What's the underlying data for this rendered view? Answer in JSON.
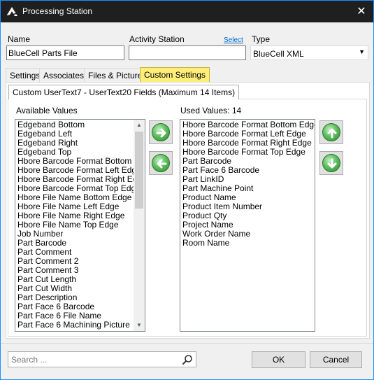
{
  "window": {
    "title": "Processing Station",
    "close_glyph": "✕",
    "icon": "app-logo-icon"
  },
  "fields": {
    "name_label": "Name",
    "name_value": "BlueCell Parts File",
    "activity_label": "Activity Station",
    "activity_select_link": "Select",
    "activity_value": "",
    "type_label": "Type",
    "type_value": "BlueCell XML"
  },
  "tabs": [
    {
      "label": "Settings"
    },
    {
      "label": "Associates"
    },
    {
      "label": "Files & Pictures"
    },
    {
      "label": "Custom Settings",
      "active": true
    }
  ],
  "subtab": {
    "label": "Custom UserText7 - UserText20 Fields (Maximum 14 Items)"
  },
  "available": {
    "label": "Available Values",
    "items": [
      "Edgeband Bottom",
      "Edgeband Left",
      "Edgeband Right",
      "Edgeband Top",
      "Hbore Barcode Format Bottom Edge",
      "Hbore Barcode Format Left Edge",
      "Hbore Barcode Format Right Edge",
      "Hbore Barcode Format Top Edge",
      "Hbore File Name Bottom Edge",
      "Hbore File Name Left Edge",
      "Hbore File Name Right Edge",
      "Hbore File Name Top Edge",
      "Job Number",
      "Part Barcode",
      "Part Comment",
      "Part Comment 2",
      "Part Comment 3",
      "Part Cut Length",
      "Part Cut Width",
      "Part Description",
      "Part Face 6 Barcode",
      "Part Face 6 File Name",
      "Part Face 6 Machining Picture"
    ]
  },
  "used": {
    "label": "Used Values: 14",
    "items": [
      "Hbore Barcode Format Bottom Edge",
      "Hbore Barcode Format Left Edge",
      "Hbore Barcode Format Right Edge",
      "Hbore Barcode Format Top Edge",
      "Part Barcode",
      "Part Face 6 Barcode",
      "Part LinkID",
      "Part Machine Point",
      "Product Name",
      "Product Item Number",
      "Product Qty",
      "Project Name",
      "Work Order Name",
      "Room Name"
    ]
  },
  "search": {
    "placeholder": "Search ..."
  },
  "buttons": {
    "ok": "OK",
    "cancel": "Cancel"
  },
  "colors": {
    "active_tab": "#ffef7a",
    "titlebar": "#1f1f1f",
    "window_border": "#1e90ff",
    "arrow_green": "#3aa03a"
  }
}
